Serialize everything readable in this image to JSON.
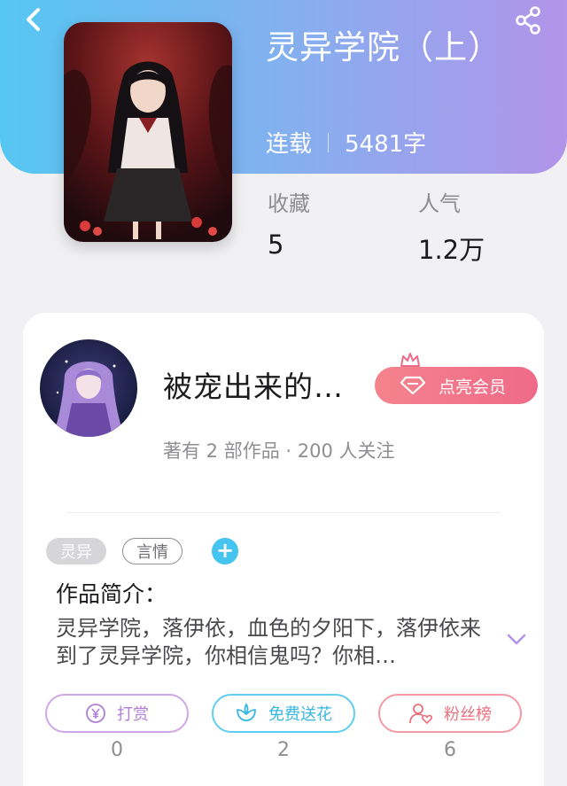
{
  "nav": {
    "back_icon": "chevron-left-icon",
    "share_icon": "share-icon"
  },
  "book": {
    "title": "灵异学院（上）",
    "status": "连载",
    "word_count": "5481字",
    "cover_title": "灵异学院（上）",
    "stats": {
      "favorites_label": "收藏",
      "favorites_value": "5",
      "popularity_label": "人气",
      "popularity_value": "1.2万"
    }
  },
  "author": {
    "name": "被宠出来的…",
    "vip_label": "点亮会员",
    "meta": "著有 2 部作品 · 200 人关注"
  },
  "tags": {
    "items": [
      "灵异",
      "言情"
    ],
    "add_label": "+"
  },
  "intro": {
    "heading": "作品简介：",
    "text": "灵异学院，落伊依，血色的夕阳下，落伊依来到了灵异学院，你相信鬼吗？你相…"
  },
  "actions": [
    {
      "label": "打赏",
      "icon": "yen-coin-icon",
      "count": "0"
    },
    {
      "label": "免费送花",
      "icon": "flower-icon",
      "count": "2"
    },
    {
      "label": "粉丝榜",
      "icon": "user-heart-icon",
      "count": "6"
    }
  ],
  "colors": {
    "header_gradient_start": "#56c6f2",
    "header_gradient_end": "#b294ea",
    "vip_pink": "#ef6a88",
    "add_tag_blue": "#45c4f0"
  }
}
